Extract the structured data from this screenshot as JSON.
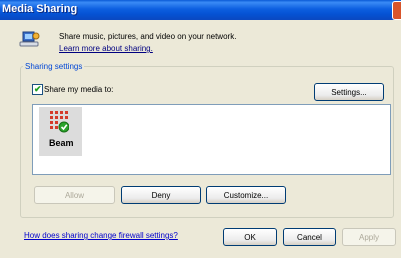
{
  "window": {
    "title": "Media Sharing"
  },
  "header": {
    "line1": "Share music, pictures, and video on your network.",
    "link": "Learn more about sharing."
  },
  "settings": {
    "group_label": "Sharing settings",
    "share_checkbox_label": "Share my media to:",
    "share_checked": true,
    "settings_button": "Settings..."
  },
  "devices": [
    {
      "label": "Beam",
      "selected": true,
      "status": "allowed"
    }
  ],
  "actions": {
    "allow": "Allow",
    "deny": "Deny",
    "customize": "Customize..."
  },
  "footer": {
    "firewall_link": "How does sharing change firewall settings?",
    "ok": "OK",
    "cancel": "Cancel",
    "apply": "Apply"
  },
  "colors": {
    "title_bar": "#0a5ad6",
    "link": "#0000cc",
    "group_label": "#0046d5"
  }
}
